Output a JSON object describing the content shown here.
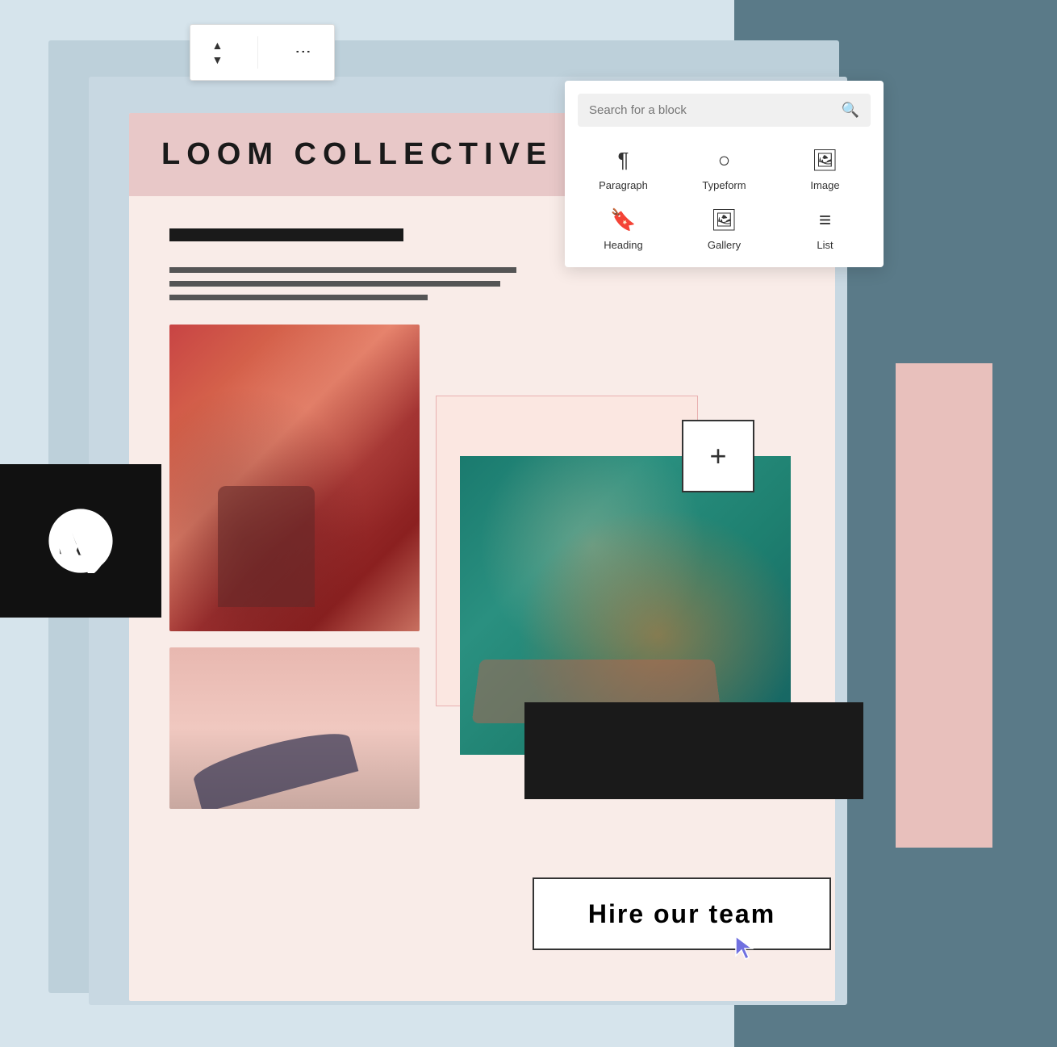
{
  "site": {
    "title": "LOOM COLLECTIVE"
  },
  "toolbar": {
    "up_arrow": "▲",
    "down_arrow": "▼",
    "more_options": "⋮"
  },
  "block_picker": {
    "search_placeholder": "Search for a block",
    "blocks": [
      {
        "id": "paragraph",
        "label": "Paragraph",
        "icon": "paragraph"
      },
      {
        "id": "typeform",
        "label": "Typeform",
        "icon": "typeform"
      },
      {
        "id": "image",
        "label": "Image",
        "icon": "image"
      },
      {
        "id": "heading",
        "label": "Heading",
        "icon": "heading"
      },
      {
        "id": "gallery",
        "label": "Gallery",
        "icon": "gallery"
      },
      {
        "id": "list",
        "label": "List",
        "icon": "list"
      }
    ]
  },
  "hire_button": {
    "label": "Hire our team"
  },
  "add_button": {
    "label": "+"
  }
}
